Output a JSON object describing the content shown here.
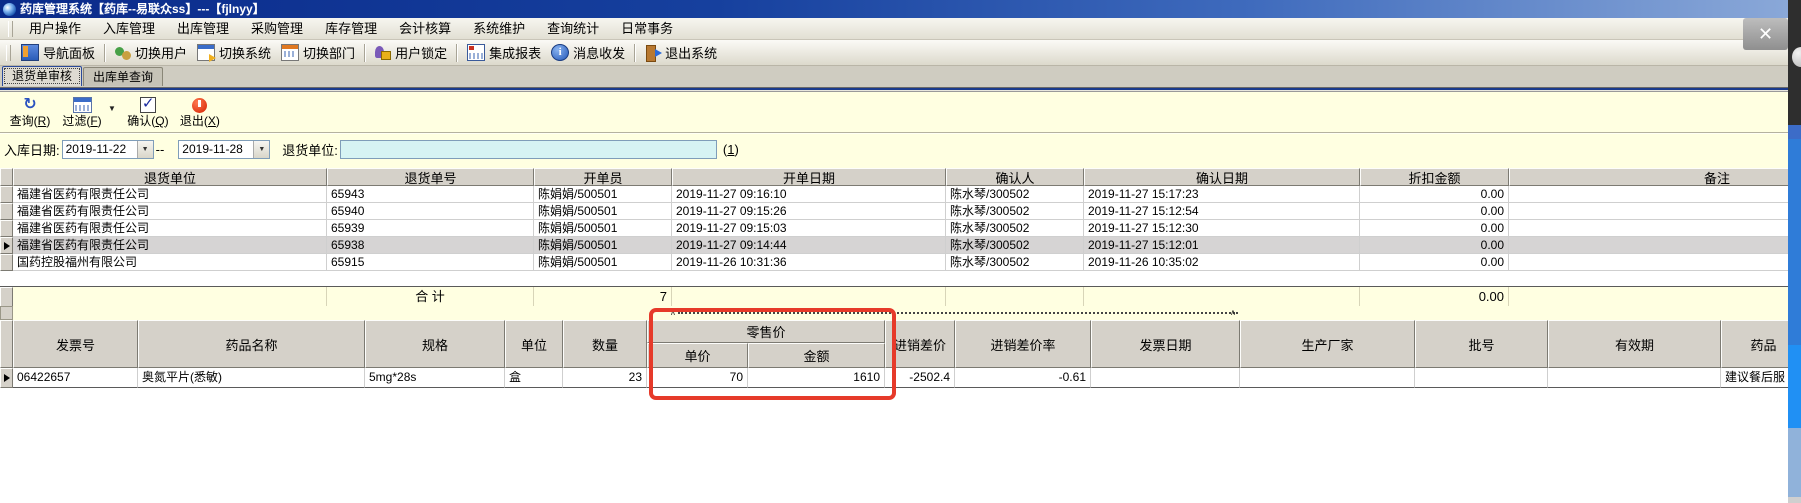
{
  "window": {
    "title": "药库管理系统【药库--易联众ss】---【fjlnyy】",
    "close_glyph": "✕"
  },
  "menu_items": [
    "用户操作",
    "入库管理",
    "出库管理",
    "采购管理",
    "库存管理",
    "会计核算",
    "系统维护",
    "查询统计",
    "日常事务"
  ],
  "toolbar_items": [
    {
      "label": "导航面板",
      "icon": "nav-panel-icon",
      "sep_after": true
    },
    {
      "label": "切换用户",
      "icon": "switch-user-icon",
      "sep_after": false
    },
    {
      "label": "切换系统",
      "icon": "switch-system-icon",
      "sep_after": false
    },
    {
      "label": "切换部门",
      "icon": "switch-dept-icon",
      "sep_after": true
    },
    {
      "label": "用户锁定",
      "icon": "user-lock-icon",
      "sep_after": true
    },
    {
      "label": "集成报表",
      "icon": "report-icon",
      "sep_after": false
    },
    {
      "label": "消息收发",
      "icon": "message-icon",
      "sep_after": true
    },
    {
      "label": "退出系统",
      "icon": "exit-system-icon",
      "sep_after": false
    }
  ],
  "tabs": [
    {
      "label": "退货单审核",
      "active": true
    },
    {
      "label": "出库单查询",
      "active": false
    }
  ],
  "actions": [
    {
      "text": "查询",
      "key": "R",
      "icon": "refresh-icon",
      "dropdown": false
    },
    {
      "text": "过滤",
      "key": "F",
      "icon": "filter-grid-icon",
      "dropdown": true
    },
    {
      "text": "确认",
      "key": "Q",
      "icon": "confirm-check-icon",
      "dropdown": false
    },
    {
      "text": "退出",
      "key": "X",
      "icon": "exit-icon",
      "dropdown": false
    }
  ],
  "filters": {
    "date_label": "入库日期:",
    "date_from": "2019-11-22",
    "date_separator": "--",
    "date_to": "2019-11-28",
    "unit_label": "退货单位:",
    "unit_value": "",
    "hint_prefix": "(",
    "hint_key": "1",
    "hint_suffix": ")"
  },
  "top_grid": {
    "headers": [
      "退货单位",
      "退货单号",
      "开单员",
      "开单日期",
      "确认人",
      "确认日期",
      "折扣金额",
      "备注"
    ],
    "rows": [
      {
        "selected": false,
        "cells": [
          "福建省医药有限责任公司",
          "65943",
          "陈娟娟/500501",
          "2019-11-27 09:16:10",
          "陈水琴/300502",
          "2019-11-27 15:17:23",
          "0.00",
          ""
        ]
      },
      {
        "selected": false,
        "cells": [
          "福建省医药有限责任公司",
          "65940",
          "陈娟娟/500501",
          "2019-11-27 09:15:26",
          "陈水琴/300502",
          "2019-11-27 15:12:54",
          "0.00",
          ""
        ]
      },
      {
        "selected": false,
        "cells": [
          "福建省医药有限责任公司",
          "65939",
          "陈娟娟/500501",
          "2019-11-27 09:15:03",
          "陈水琴/300502",
          "2019-11-27 15:12:30",
          "0.00",
          ""
        ]
      },
      {
        "selected": true,
        "cells": [
          "福建省医药有限责任公司",
          "65938",
          "陈娟娟/500501",
          "2019-11-27 09:14:44",
          "陈水琴/300502",
          "2019-11-27 15:12:01",
          "0.00",
          ""
        ]
      },
      {
        "selected": false,
        "cells": [
          "国药控股福州有限公司",
          "65915",
          "陈娟娟/500501",
          "2019-11-26 10:31:36",
          "陈水琴/300502",
          "2019-11-26 10:35:02",
          "0.00",
          ""
        ]
      }
    ],
    "total": {
      "label": "合 计",
      "count": "7",
      "discount": "0.00"
    }
  },
  "bottom_grid": {
    "group_header": "零售价",
    "headers": [
      "发票号",
      "药品名称",
      "规格",
      "单位",
      "数量",
      "单价",
      "金额",
      "进销差价",
      "进销差价率",
      "发票日期",
      "生产厂家",
      "批号",
      "有效期",
      "药品"
    ],
    "row": [
      "06422657",
      "奥氮平片(悉敏)",
      "5mg*28s",
      "盒",
      "23",
      "70",
      "1610",
      "-2502.4",
      "-0.61",
      "",
      "",
      "",
      "",
      "建议餐后服"
    ]
  },
  "colors": {
    "annotation_red": "#e63a2a",
    "panel_yellow": "#ffffe1",
    "input_cyan": "#d6f3f3",
    "title_blue": "#0a2a8a",
    "header_gray": "#d5d1c9",
    "right_strip_blue": "#2f7cd8"
  }
}
